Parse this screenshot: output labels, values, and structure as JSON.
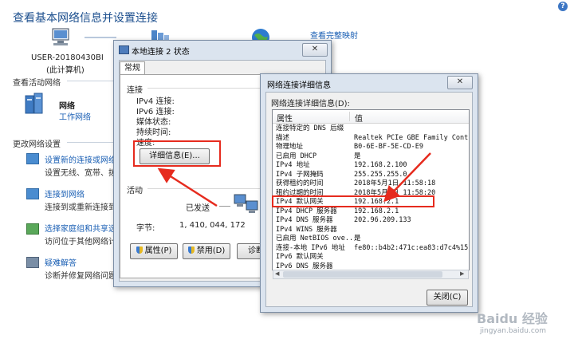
{
  "background": {
    "title": "查看基本网络信息并设置连接",
    "view_full_map": "查看完整映射",
    "computer_name": "USER-20180430BI",
    "computer_sub": "(此计算机)",
    "active_networks_heading": "查看活动网络",
    "network_name": "网络",
    "network_type": "工作网络",
    "change_settings_heading": "更改网络设置",
    "tasks": [
      {
        "title": "设置新的连接或网络",
        "desc": "设置无线、宽带、拨号"
      },
      {
        "title": "连接到网络",
        "desc": "连接到或重新连接到无"
      },
      {
        "title": "选择家庭组和共享选项",
        "desc": "访问位于其他网络计算"
      },
      {
        "title": "疑难解答",
        "desc": "诊断并修复网络问题，"
      }
    ]
  },
  "status_window": {
    "title": "本地连接 2 状态",
    "close": "✕",
    "tab": "常规",
    "connection_group": "连接",
    "fields": [
      "IPv4 连接:",
      "IPv6 连接:",
      "媒体状态:",
      "持续时间:",
      "速度:"
    ],
    "details_button": "详细信息(E)...",
    "activity_group": "活动",
    "sent_label": "已发送",
    "bytes_label": "字节:",
    "bytes_value": "1, 410, 044, 172",
    "properties_button": "属性(P)",
    "disable_button": "禁用(D)",
    "diagnose_button": "诊断"
  },
  "details_window": {
    "title": "网络连接详细信息",
    "close": "✕",
    "list_label": "网络连接详细信息(D):",
    "col_property": "属性",
    "col_value": "值",
    "rows": [
      {
        "p": "连接特定的 DNS 后缀",
        "v": ""
      },
      {
        "p": "描述",
        "v": "Realtek PCIe GBE Family Contro"
      },
      {
        "p": "物理地址",
        "v": "B0-6E-BF-5E-CD-E9"
      },
      {
        "p": "已启用 DHCP",
        "v": "是"
      },
      {
        "p": "IPv4 地址",
        "v": "192.168.2.100"
      },
      {
        "p": "IPv4 子网掩码",
        "v": "255.255.255.0"
      },
      {
        "p": "获得租约的时间",
        "v": "2018年5月1日 11:58:18"
      },
      {
        "p": "租约过期的时间",
        "v": "2018年5月1日 11:58:20"
      },
      {
        "p": "IPv4 默认网关",
        "v": "192.168.2.1"
      },
      {
        "p": "IPv4 DHCP 服务器",
        "v": "192.168.2.1"
      },
      {
        "p": "IPv4 DNS 服务器",
        "v": "202.96.209.133"
      },
      {
        "p": "IPv4 WINS 服务器",
        "v": ""
      },
      {
        "p": "已启用 NetBIOS ove...",
        "v": "是"
      },
      {
        "p": "连接-本地 IPv6 地址",
        "v": "fe80::b4b2:471c:ea83:d7c4%15"
      },
      {
        "p": "IPv6 默认网关",
        "v": ""
      },
      {
        "p": "IPv6 DNS 服务器",
        "v": ""
      }
    ],
    "close_button": "关闭(C)"
  },
  "watermark": {
    "text": "Baidu 经验",
    "url": "jingyan.baidu.com"
  },
  "colors": {
    "annotation_red": "#e62b1e",
    "link_blue": "#1a5fb4",
    "window_frame": "#dbe4ef"
  }
}
